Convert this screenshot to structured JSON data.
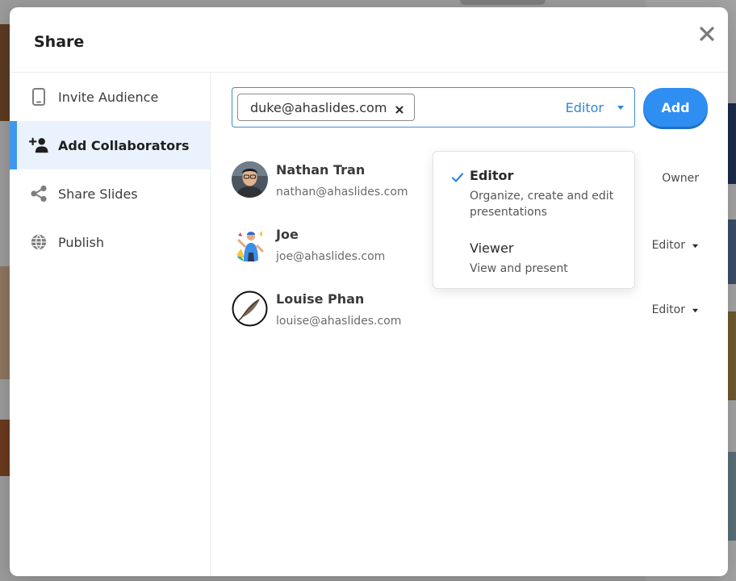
{
  "modal": {
    "title": "Share"
  },
  "sidebar": {
    "items": [
      {
        "label": "Invite Audience",
        "icon": "phone-icon"
      },
      {
        "label": "Add Collaborators",
        "icon": "add-user-icon",
        "active": true
      },
      {
        "label": "Share Slides",
        "icon": "share-icon"
      },
      {
        "label": "Publish",
        "icon": "globe-icon"
      }
    ]
  },
  "invite": {
    "chip_email": "duke@ahaslides.com",
    "role": "Editor",
    "add_label": "Add"
  },
  "collaborators": [
    {
      "name": "Nathan Tran",
      "email": "nathan@ahaslides.com",
      "role": "Owner"
    },
    {
      "name": "Joe",
      "email": "joe@ahaslides.com",
      "role": "Editor"
    },
    {
      "name": "Louise Phan",
      "email": "louise@ahaslides.com",
      "role": "Editor"
    }
  ],
  "dropdown": {
    "options": [
      {
        "label": "Editor",
        "desc": "Organize, create and edit presentations",
        "selected": true
      },
      {
        "label": "Viewer",
        "desc": "View and present",
        "selected": false
      }
    ]
  },
  "colors": {
    "accent": "#2f8ef1",
    "active_bg": "#eaf3fd",
    "active_bar": "#3f97ef",
    "link": "#2f86d6"
  }
}
